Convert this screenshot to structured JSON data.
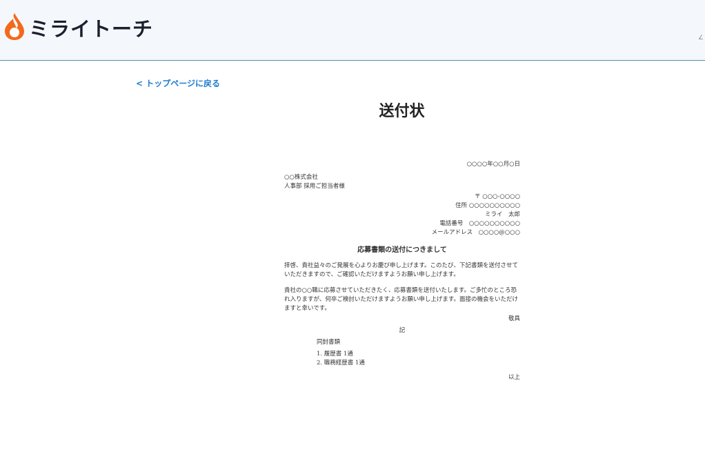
{
  "header": {
    "logo_text": "ミライトーチ",
    "logo_mark_icon": "flame-icon",
    "edge_mark": "∠"
  },
  "nav": {
    "back_link": "< トップページに戻る"
  },
  "page": {
    "title": "送付状"
  },
  "letter": {
    "date": "○○○○年○○月○日",
    "recipient_company": "○○株式会社",
    "recipient_person": "人事部 採用ご担当者様",
    "sender_postal": "〒 ○○○-○○○○",
    "sender_address": "住所 ○○○○○○○○○○",
    "sender_name": "ミライ　太郎",
    "sender_phone": "電話番号　○○○○○○○○○○",
    "sender_email": "メールアドレス　○○○○@○○○",
    "subject": "応募書類の送付につきまして",
    "paragraph1": "拝啓、貴社益々のご発展を心よりお慶び申し上げます。このたび、下記書類を送付させていただきますので、ご確認いただけますようお願い申し上げます。",
    "paragraph2": "貴社の○○職に応募させていただきたく、応募書類を送付いたします。ご多忙のところ恐れ入りますが、何卒ご検討いただけますようお願い申し上げます。面接の機会をいただけますと幸いです。",
    "closing": "敬具",
    "ki": "記",
    "enclosed_heading": "同封書類",
    "enclosed_items": [
      "1. 履歴書 1通",
      "2. 職務経歴書 1通"
    ],
    "end": "以上"
  }
}
